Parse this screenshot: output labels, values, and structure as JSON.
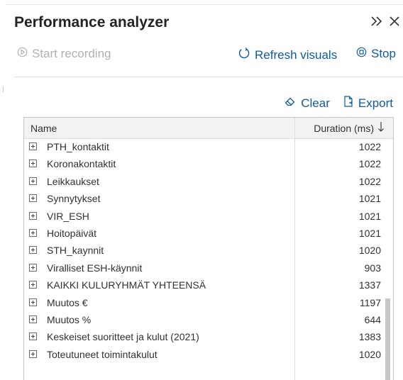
{
  "panel": {
    "title": "Performance analyzer"
  },
  "toolbar": {
    "start_label": "Start recording",
    "refresh_label": "Refresh visuals",
    "stop_label": "Stop"
  },
  "actions": {
    "clear_label": "Clear",
    "export_label": "Export"
  },
  "table": {
    "col_name": "Name",
    "col_duration": "Duration (ms)",
    "rows": [
      {
        "name": "PTH_kontaktit",
        "duration": "1022"
      },
      {
        "name": "Koronakontaktit",
        "duration": "1022"
      },
      {
        "name": "Leikkaukset",
        "duration": "1022"
      },
      {
        "name": "Synnytykset",
        "duration": "1021"
      },
      {
        "name": "VIR_ESH",
        "duration": "1021"
      },
      {
        "name": "Hoitopäivät",
        "duration": "1021"
      },
      {
        "name": "STH_kaynnit",
        "duration": "1020"
      },
      {
        "name": "Viralliset ESH-käynnit",
        "duration": "903"
      },
      {
        "name": "KAIKKI KULURYHMÄT YHTEENSÄ",
        "duration": "1337"
      },
      {
        "name": "Muutos €",
        "duration": "1197"
      },
      {
        "name": "Muutos %",
        "duration": "644"
      },
      {
        "name": "Keskeiset suoritteet ja kulut (2021)",
        "duration": "1383"
      },
      {
        "name": "Toteutuneet toimintakulut",
        "duration": "1020"
      }
    ]
  },
  "colors": {
    "link": "#0f5a9e",
    "disabled": "#b3b0ad",
    "header_bg": "#f3f2f1"
  }
}
